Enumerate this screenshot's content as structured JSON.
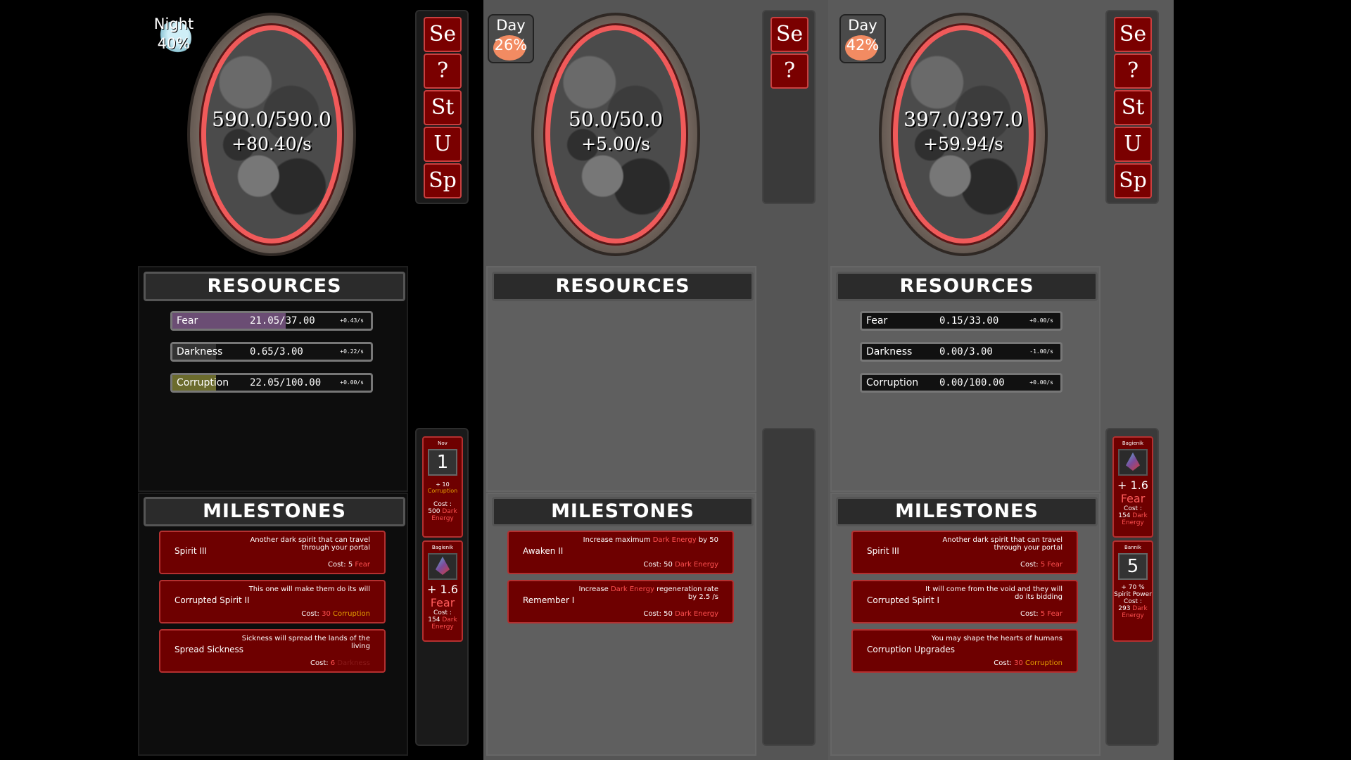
{
  "panels": [
    {
      "time_label": "Night",
      "time_pct": "40%",
      "portal_value": "590.0/590.0",
      "portal_rate": "+80.40/s",
      "resources_title": "RESOURCES",
      "resources": [
        {
          "name": "Fear",
          "amount": "21.05/37.00",
          "rate": "+0.43/s",
          "fill": 0.57,
          "color": "#6b4d74"
        },
        {
          "name": "Darkness",
          "amount": "0.65/3.00",
          "rate": "+0.22/s",
          "fill": 0.22,
          "color": "#333"
        },
        {
          "name": "Corruption",
          "amount": "22.05/100.00",
          "rate": "+0.00/s",
          "fill": 0.22,
          "color": "#6b6b2d"
        }
      ],
      "milestones_title": "MILESTONES",
      "milestones": [
        {
          "name": "Spirit III",
          "desc": "Another dark spirit that can travel through your portal",
          "cost_label": "Cost: ",
          "cost_amount": "5",
          "cost_unit": "Fear"
        },
        {
          "name": "Corrupted Spirit II",
          "desc": "This one will make them do its will",
          "cost_label": "Cost: ",
          "cost_amount": "30",
          "cost_unit": "Corruption"
        },
        {
          "name": "Spread Sickness",
          "desc": "Sickness will spread the lands of the living",
          "cost_label": "Cost: ",
          "cost_amount": "6",
          "cost_unit": "Darkness"
        }
      ],
      "side_buttons": [
        "Se",
        "?",
        "St",
        "U",
        "Sp"
      ],
      "cards": [
        {
          "title": "Nov",
          "type": "number",
          "num": "1",
          "line1": "+ 10",
          "line2": "Corruption",
          "cost_label": "Cost :",
          "cost_amount": "500",
          "cost_unit": "Dark Energy"
        },
        {
          "title": "Bagienik",
          "type": "gem",
          "num": "+ 1.6",
          "line2": "Fear",
          "cost_label": "Cost :",
          "cost_amount": "154",
          "cost_unit": "Dark Energy"
        }
      ]
    },
    {
      "time_label": "Day",
      "time_pct": "26%",
      "portal_value": "50.0/50.0",
      "portal_rate": "+5.00/s",
      "resources_title": "RESOURCES",
      "milestones_title": "MILESTONES",
      "milestones": [
        {
          "name": "Awaken II",
          "desc_pre": "Increase maximum ",
          "desc_hl": "Dark Energy",
          "desc_post": " by 50",
          "cost_label": "Cost: 50 ",
          "cost_unit": "Dark Energy"
        },
        {
          "name": "Remember I",
          "desc_pre": "Increase ",
          "desc_hl": "Dark Energy",
          "desc_post": " regeneration rate by 2.5 /s",
          "cost_label": "Cost: 50 ",
          "cost_unit": "Dark Energy"
        }
      ],
      "side_buttons": [
        "Se",
        "?"
      ]
    },
    {
      "time_label": "Day",
      "time_pct": "42%",
      "portal_value": "397.0/397.0",
      "portal_rate": "+59.94/s",
      "resources_title": "RESOURCES",
      "resources": [
        {
          "name": "Fear",
          "amount": "0.15/33.00",
          "rate": "+0.00/s"
        },
        {
          "name": "Darkness",
          "amount": "0.00/3.00",
          "rate": "-1.00/s"
        },
        {
          "name": "Corruption",
          "amount": "0.00/100.00",
          "rate": "+0.00/s"
        }
      ],
      "milestones_title": "MILESTONES",
      "milestones": [
        {
          "name": "Spirit III",
          "desc": "Another dark spirit that can travel through your portal",
          "cost_label": "Cost: ",
          "cost_amount": "5",
          "cost_unit": "Fear"
        },
        {
          "name": "Corrupted Spirit I",
          "desc": "It will come from the void and they will do its bidding",
          "cost_label": "Cost: ",
          "cost_amount": "5",
          "cost_unit": "Fear"
        },
        {
          "name": "Corruption Upgrades",
          "desc": "You may shape the hearts of humans",
          "cost_label": "Cost: ",
          "cost_amount": "30",
          "cost_unit": "Corruption"
        }
      ],
      "side_buttons": [
        "Se",
        "?",
        "St",
        "U",
        "Sp"
      ],
      "cards": [
        {
          "title": "Bagienik",
          "type": "gem",
          "num": "+ 1.6",
          "line2": "Fear",
          "cost_label": "Cost :",
          "cost_amount": "154",
          "cost_unit": "Dark Energy"
        },
        {
          "title": "Bannik",
          "type": "number",
          "num": "5",
          "line1": "+ 70 %",
          "line2": "Spirit Power",
          "cost_label": "Cost :",
          "cost_amount": "293",
          "cost_unit": "Dark Energy"
        }
      ]
    }
  ],
  "colors": {
    "accent_red": "#7a0000",
    "portal_ring": "#f05a5a",
    "highlight": "#ff5050",
    "corruption": "#e5a000"
  }
}
